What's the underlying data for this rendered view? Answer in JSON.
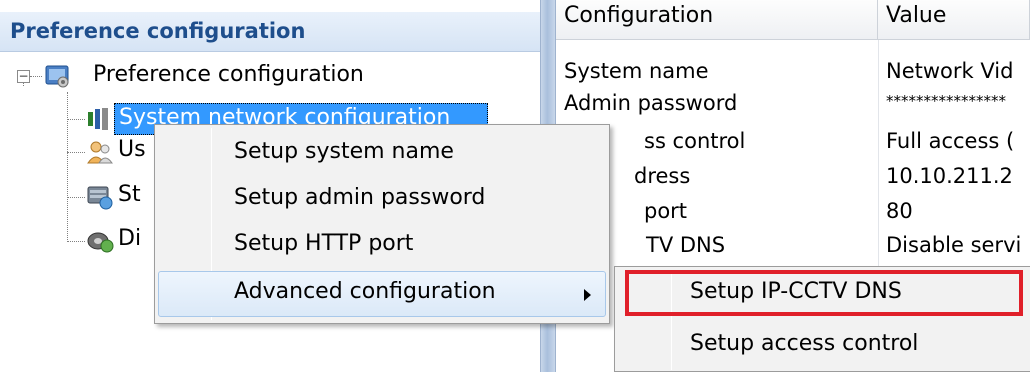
{
  "left_panel": {
    "header": "Preference configuration",
    "tree": {
      "root": {
        "label": "Preference configuration",
        "expander": "−"
      },
      "children": [
        {
          "label": "System network configuration",
          "icon": "network-config-icon",
          "selected": true
        },
        {
          "label": "Us",
          "icon": "users-icon"
        },
        {
          "label": "St",
          "icon": "storage-icon"
        },
        {
          "label": "Di",
          "icon": "disk-icon"
        }
      ]
    }
  },
  "grid": {
    "columns": [
      "Configuration",
      "Value"
    ],
    "rows": [
      {
        "config": "System name",
        "value": "Network Vid"
      },
      {
        "config": "Admin password",
        "value": "****************"
      },
      {
        "config": "ss control",
        "value": "Full access ("
      },
      {
        "config": "dress",
        "value": "10.10.211.2"
      },
      {
        "config": "port",
        "value": "80"
      },
      {
        "config": "TV DNS",
        "value": "Disable servi"
      }
    ]
  },
  "context_menu": {
    "items": [
      {
        "label": "Setup system name"
      },
      {
        "label": "Setup admin password"
      },
      {
        "label": "Setup HTTP port"
      },
      {
        "label": "Advanced configuration",
        "has_submenu": true,
        "hover": true
      }
    ]
  },
  "submenu": {
    "items": [
      {
        "label": "Setup IP-CCTV DNS",
        "highlighted": true
      },
      {
        "label": "Setup access control"
      }
    ],
    "highlight_color": "#e0202a"
  },
  "colors": {
    "header_text": "#1e4e8c",
    "selection": "#3399ff",
    "menu_bg": "#f2f2f2"
  }
}
